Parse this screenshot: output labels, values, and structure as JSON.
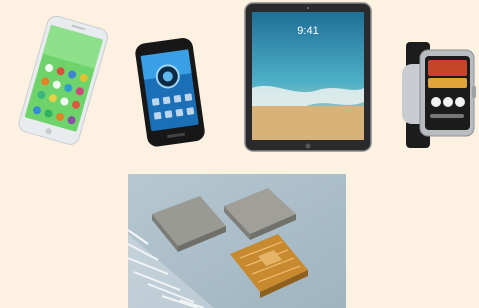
{
  "scene": {
    "background_color": "#fdf1e2",
    "items": [
      {
        "name": "white-smartphone",
        "icon": "smartphone-icon",
        "screen_color": "#6fd36b"
      },
      {
        "name": "black-smartphone",
        "icon": "camera-lens-icon",
        "screen_color": "#1a6fb6"
      },
      {
        "name": "tablet",
        "icon": "tablet-icon",
        "screen_color": "#3d8fb2"
      },
      {
        "name": "smartwatch",
        "icon": "smartwatch-icon",
        "screen_color": "#1b1b1b"
      },
      {
        "name": "chip-components-photo",
        "icon": "chip-icon",
        "photo_background": "#a9bdc8"
      }
    ],
    "tablet_clock": "9:41"
  }
}
